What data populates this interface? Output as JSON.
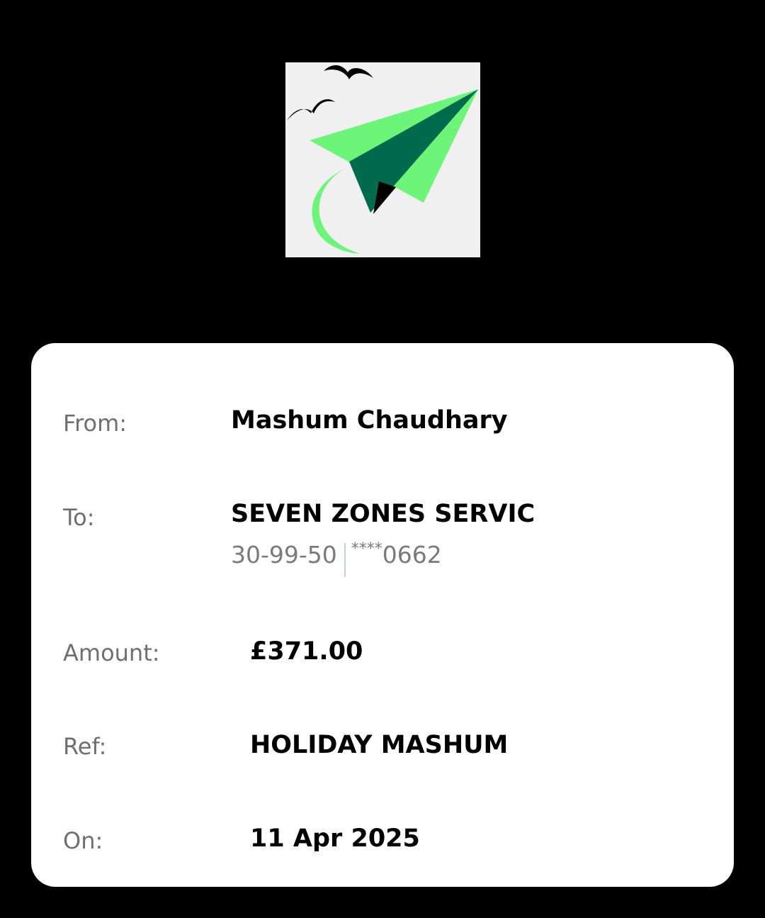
{
  "receipt": {
    "from_label": "From:",
    "from_value": "Mashum Chaudhary",
    "to_label": "To:",
    "to_value": "SEVEN ZONES SERVIC",
    "sort_code": "30-99-50",
    "account_mask": "****",
    "account_last4": "0662",
    "amount_label": "Amount:",
    "amount_value": "£371.00",
    "ref_label": "Ref:",
    "ref_value": "HOLIDAY MASHUM",
    "on_label": "On:",
    "on_value": "11 Apr 2025"
  },
  "colors": {
    "background": "#000000",
    "card": "#ffffff",
    "logo_bg": "#f0f0f0",
    "plane_light": "#6df57a",
    "plane_dark": "#006b4c"
  },
  "icons": {
    "logo": "paper-plane-logo-icon",
    "birds": "birds-icon"
  }
}
